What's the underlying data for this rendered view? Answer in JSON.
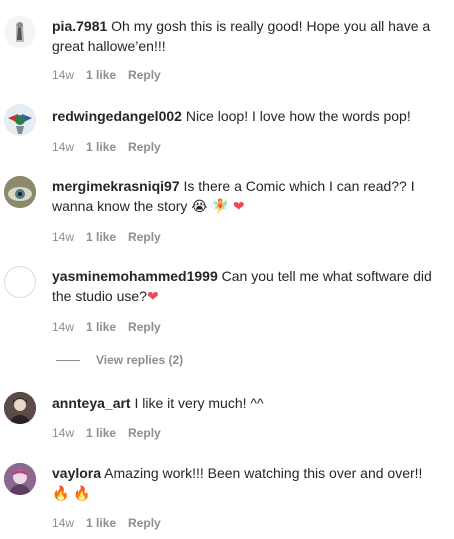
{
  "comments": [
    {
      "username": "pia.7981",
      "text": "Oh my gosh this is really good! Hope you all have a great hallowe’en!!!",
      "time": "14w",
      "likes": "1 like",
      "reply": "Reply"
    },
    {
      "username": "redwingedangel002",
      "text": "Nice loop! I love how the words pop!",
      "time": "14w",
      "likes": "1 like",
      "reply": "Reply"
    },
    {
      "username": "mergimekrasniqi97",
      "text": "Is there a Comic which I can read?? I wanna know the story",
      "emoji": [
        "😭",
        "🧚",
        "❤"
      ],
      "time": "14w",
      "likes": "1 like",
      "reply": "Reply"
    },
    {
      "username": "yasminemohammed1999",
      "text": "Can you tell me what software did the studio use?",
      "emoji": [
        "❤"
      ],
      "time": "14w",
      "likes": "1 like",
      "reply": "Reply",
      "view_replies": "View replies (2)"
    },
    {
      "username": "annteya_art",
      "text": "I like it very much! ^^",
      "time": "14w",
      "likes": "1 like",
      "reply": "Reply"
    },
    {
      "username": "vaylora",
      "text": "Amazing work!!! Been watching this over and over!!",
      "emoji": [
        "🔥",
        "🔥"
      ],
      "time": "14w",
      "likes": "1 like",
      "reply": "Reply"
    }
  ],
  "icons": {
    "heart": "heart-emoji",
    "fire": "fire-emoji",
    "crying": "crying-face-emoji",
    "fairy": "fairy-emoji"
  }
}
